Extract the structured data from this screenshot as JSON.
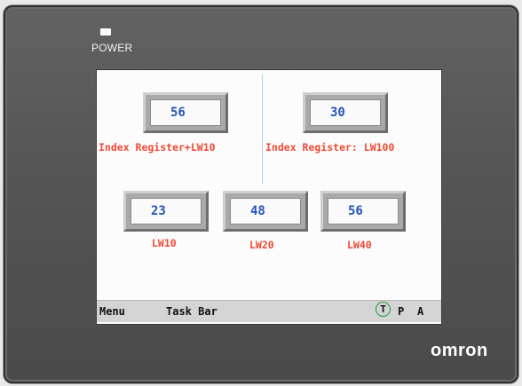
{
  "device": {
    "power_label": "POWER",
    "brand": "omron"
  },
  "screen": {
    "top_boxes": [
      {
        "value": "56",
        "label": "Index Register+LW10"
      },
      {
        "value": "30",
        "label": "Index Register: LW100"
      }
    ],
    "bottom_boxes": [
      {
        "value": "23",
        "label": "LW10"
      },
      {
        "value": "48",
        "label": "LW20"
      },
      {
        "value": "56",
        "label": "LW40"
      }
    ],
    "taskbar": {
      "menu_label": "Menu",
      "taskbar_label": "Task Bar",
      "indicators": [
        "T",
        "P",
        "A"
      ]
    }
  },
  "colors": {
    "value_text": "#2354b8",
    "label_text": "#f04a35",
    "bezel": "#555555",
    "indicator_ring": "#1f9a3a"
  }
}
